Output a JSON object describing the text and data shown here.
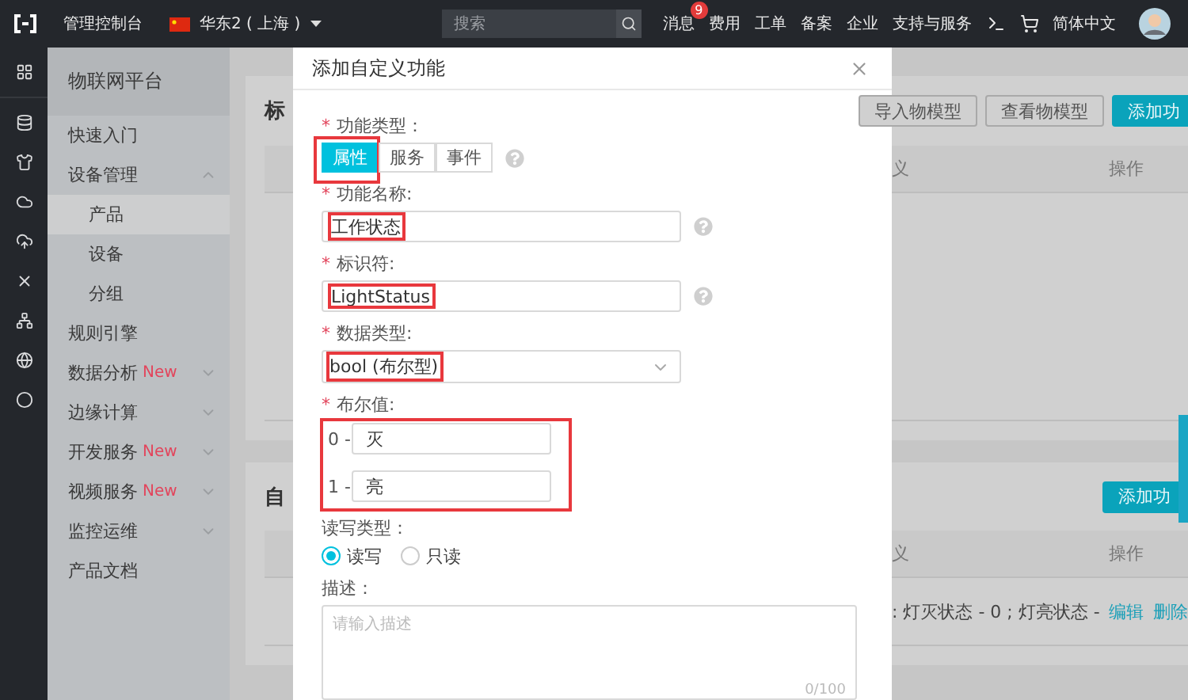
{
  "top_bar": {
    "console_label": "管理控制台",
    "region": "华东2 ( 上海 )",
    "search": {
      "placeholder": "搜索"
    },
    "nav": [
      {
        "label": "消息",
        "badge": "9"
      },
      {
        "label": "费用"
      },
      {
        "label": "工单"
      },
      {
        "label": "备案"
      },
      {
        "label": "企业"
      },
      {
        "label": "支持与服务"
      }
    ],
    "language": "简体中文"
  },
  "sidebar": {
    "title": "物联网平台",
    "items": [
      {
        "label": "快速入门",
        "selected": false
      },
      {
        "label": "设备管理",
        "selected": false,
        "expanded": true,
        "children": [
          {
            "label": "产品",
            "selected": true
          },
          {
            "label": "设备",
            "selected": false
          },
          {
            "label": "分组",
            "selected": false
          }
        ]
      },
      {
        "label": "规则引擎",
        "selected": false
      },
      {
        "label": "数据分析",
        "badge": "New",
        "selected": false,
        "expanded": false
      },
      {
        "label": "边缘计算",
        "selected": false,
        "expanded": false
      },
      {
        "label": "开发服务",
        "badge": "New",
        "selected": false,
        "expanded": false
      },
      {
        "label": "视频服务",
        "badge": "New",
        "selected": false,
        "expanded": false
      },
      {
        "label": "监控运维",
        "selected": false,
        "expanded": false
      },
      {
        "label": "产品文档",
        "selected": false
      }
    ]
  },
  "standard_section": {
    "title": "标",
    "buttons": [
      {
        "label": "导入物模型",
        "primary": false
      },
      {
        "label": "查看物模型",
        "primary": false
      },
      {
        "label": "添加功",
        "primary": true
      }
    ],
    "columns": [
      "义",
      "操作"
    ]
  },
  "custom_section": {
    "title": "自",
    "buttons": [
      {
        "label": "添加功",
        "primary": true
      }
    ],
    "columns": [
      "义",
      "操作"
    ],
    "rows": [
      {
        "cell": ": 灯灭状态 - 0 ; 灯亮状态 -",
        "actions": [
          "编辑",
          "删除"
        ]
      }
    ]
  },
  "dialog": {
    "title": "添加自定义功能",
    "fields": [
      {
        "kind": "segmented",
        "label": "功能类型：",
        "required_mark": "*",
        "help": true,
        "options": [
          {
            "label": "属性",
            "selected": true,
            "highlighted": true
          },
          {
            "label": "服务",
            "selected": false,
            "highlighted": false
          },
          {
            "label": "事件",
            "selected": false,
            "highlighted": false
          }
        ]
      },
      {
        "kind": "text",
        "label": "功能名称:",
        "required_mark": "*",
        "help": true,
        "value": "工作状态",
        "highlighted": true
      },
      {
        "kind": "text",
        "label": "标识符:",
        "required_mark": "*",
        "help": true,
        "value": "LightStatus",
        "highlighted": true
      },
      {
        "kind": "select",
        "label": "数据类型:",
        "required_mark": "*",
        "value": "bool (布尔型)",
        "highlighted": true
      },
      {
        "kind": "bool_values",
        "label": "布尔值:",
        "required_mark": "*",
        "highlighted": true,
        "rows": [
          {
            "prefix": "0 -",
            "value": "灭"
          },
          {
            "prefix": "1 -",
            "value": "亮"
          }
        ]
      },
      {
        "kind": "radio",
        "label": "读写类型：",
        "options": [
          {
            "label": "读写",
            "selected": true
          },
          {
            "label": "只读",
            "selected": false
          }
        ]
      },
      {
        "kind": "textarea",
        "label": "描述：",
        "placeholder": "请输入描述",
        "counter": "0/100"
      }
    ]
  }
}
